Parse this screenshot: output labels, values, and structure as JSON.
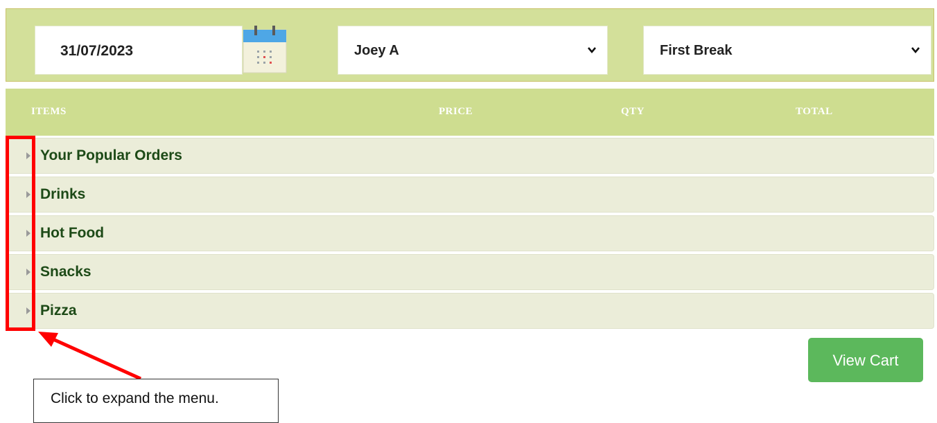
{
  "filters": {
    "date_value": "31/07/2023",
    "student_selected": "Joey A",
    "break_selected": "First Break"
  },
  "table_header": {
    "items": "ITEMS",
    "price": "PRICE",
    "qty": "QTY",
    "total": "TOTAL"
  },
  "categories": [
    {
      "label": "Your Popular Orders"
    },
    {
      "label": "Drinks"
    },
    {
      "label": "Hot Food"
    },
    {
      "label": "Snacks"
    },
    {
      "label": "Pizza"
    }
  ],
  "actions": {
    "view_cart_label": "View Cart"
  },
  "annotation": {
    "callout_text": "Click to expand the menu."
  },
  "icons": {
    "calendar": "calendar-icon",
    "dropdown": "chevron-down-icon",
    "expand": "caret-right-icon"
  },
  "colors": {
    "filter_bar_bg": "#d3e09a",
    "header_bg": "#cedd90",
    "row_bg": "#ebedd9",
    "category_text": "#1d4a17",
    "view_cart_bg": "#5cb85c",
    "annotation_red": "#ff0000"
  }
}
